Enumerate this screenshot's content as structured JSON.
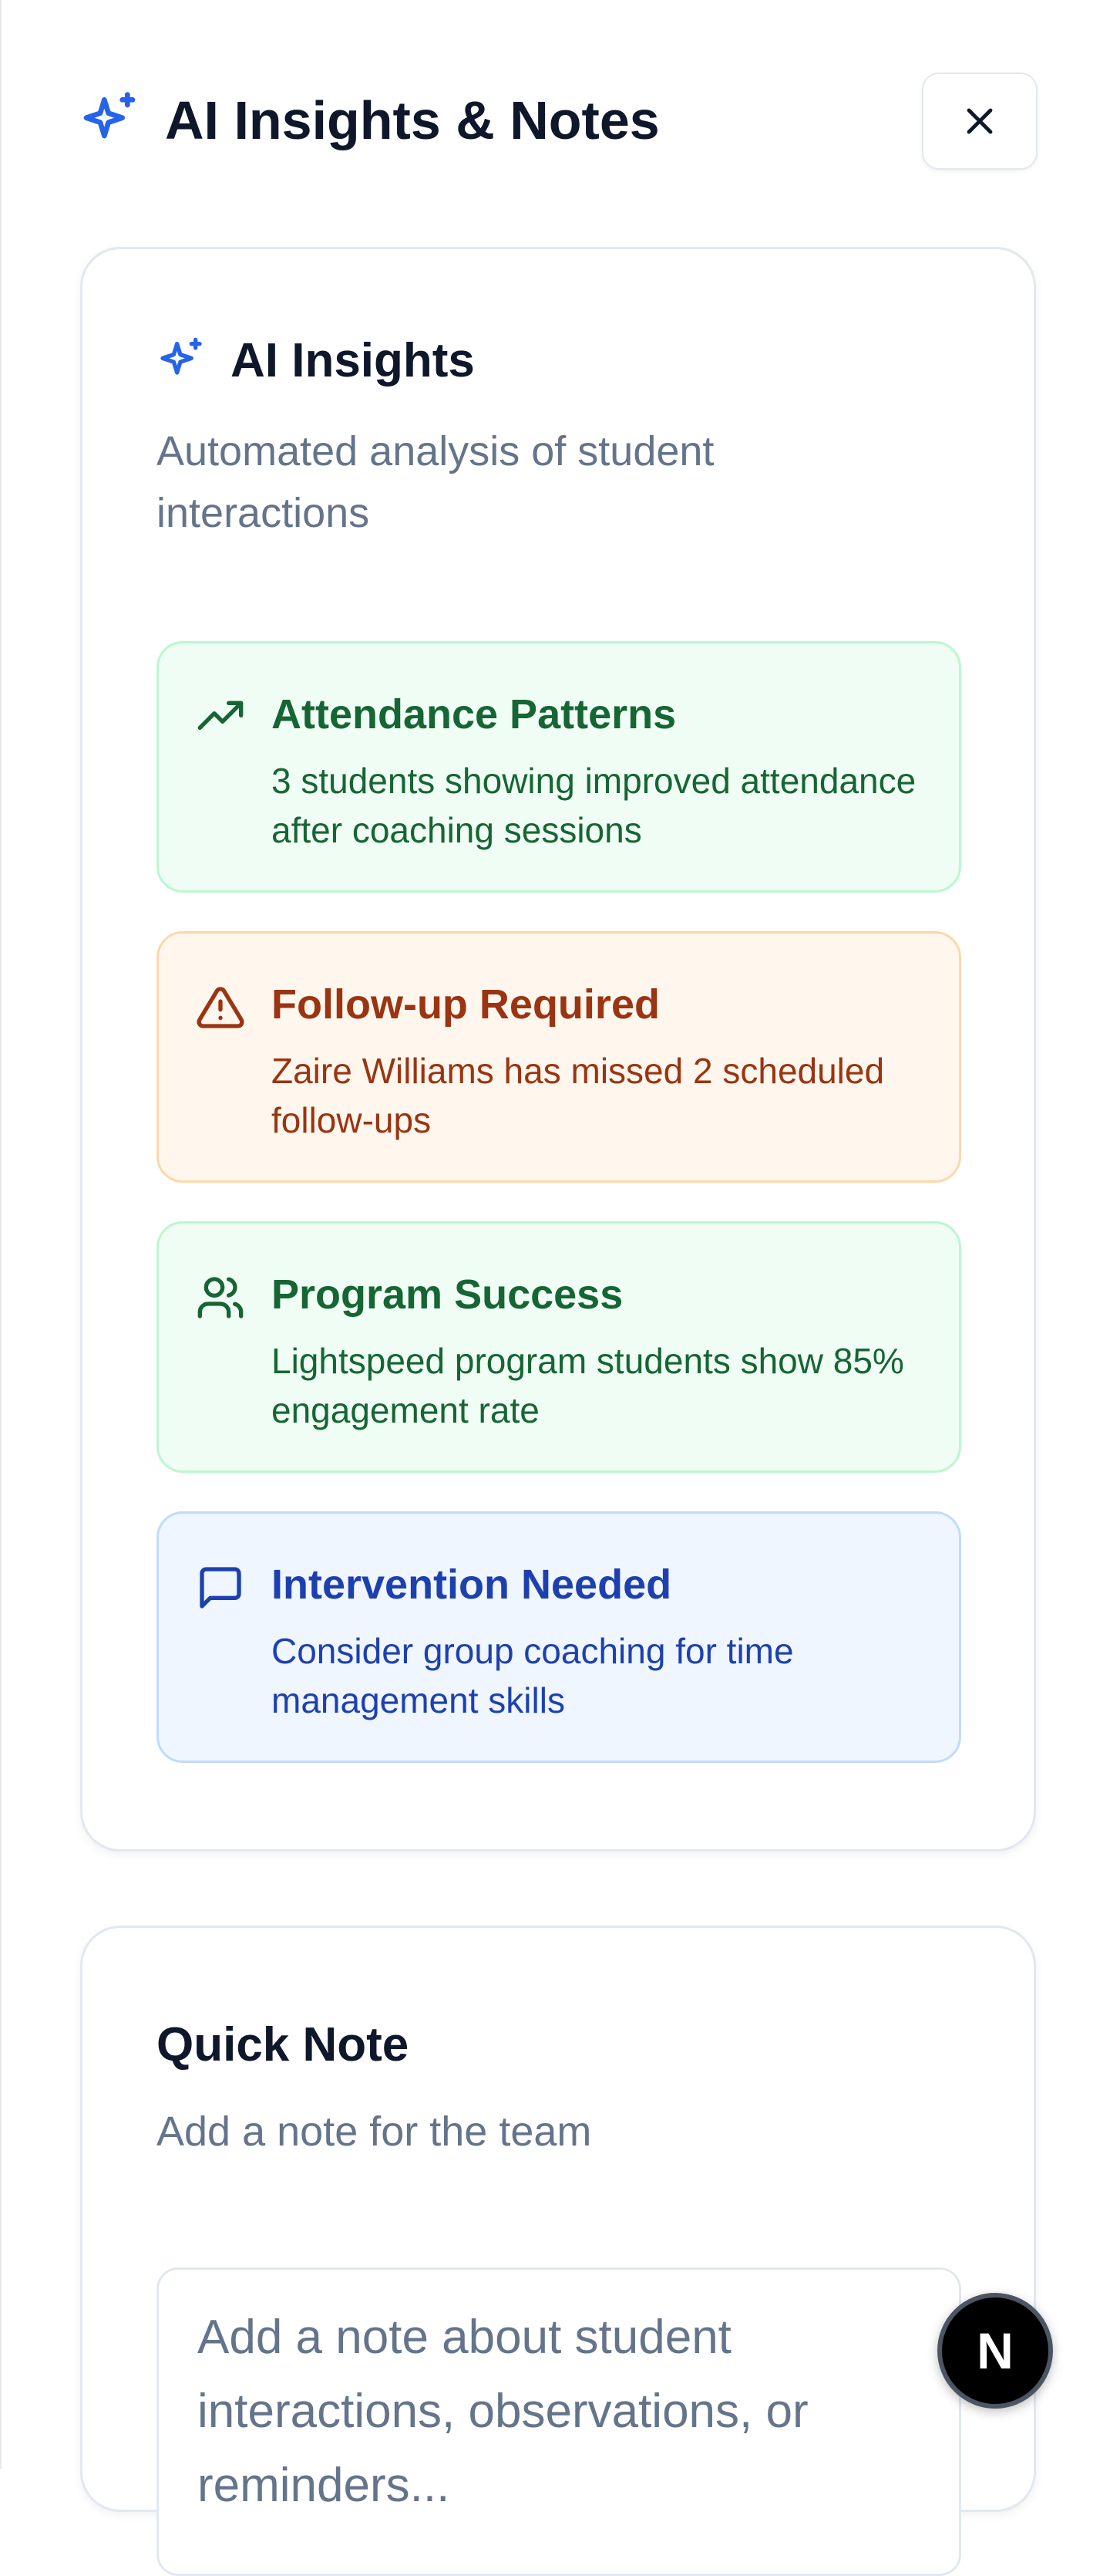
{
  "header": {
    "title": "AI Insights & Notes",
    "icon": "sparkles-icon",
    "close_icon": "close-icon"
  },
  "insights_card": {
    "title": "AI Insights",
    "description": "Automated analysis of student interactions",
    "items": [
      {
        "icon": "trending-up-icon",
        "title": "Attendance Patterns",
        "text": "3 students showing improved attendance after coaching sessions",
        "tone": "success"
      },
      {
        "icon": "warning-triangle-icon",
        "title": "Follow-up Required",
        "text": "Zaire Williams has missed 2 scheduled follow-ups",
        "tone": "warning"
      },
      {
        "icon": "users-icon",
        "title": "Program Success",
        "text": "Lightspeed program students show 85% engagement rate",
        "tone": "success"
      },
      {
        "icon": "message-square-icon",
        "title": "Intervention Needed",
        "text": "Consider group coaching for time management skills",
        "tone": "info"
      }
    ]
  },
  "note_card": {
    "title": "Quick Note",
    "description": "Add a note for the team",
    "placeholder": "Add a note about student interactions, observations, or reminders..."
  },
  "badge": {
    "label": "N"
  },
  "colors": {
    "accent": "#2563eb",
    "success": "#166534",
    "warning": "#9a3412",
    "info": "#1e40af"
  }
}
